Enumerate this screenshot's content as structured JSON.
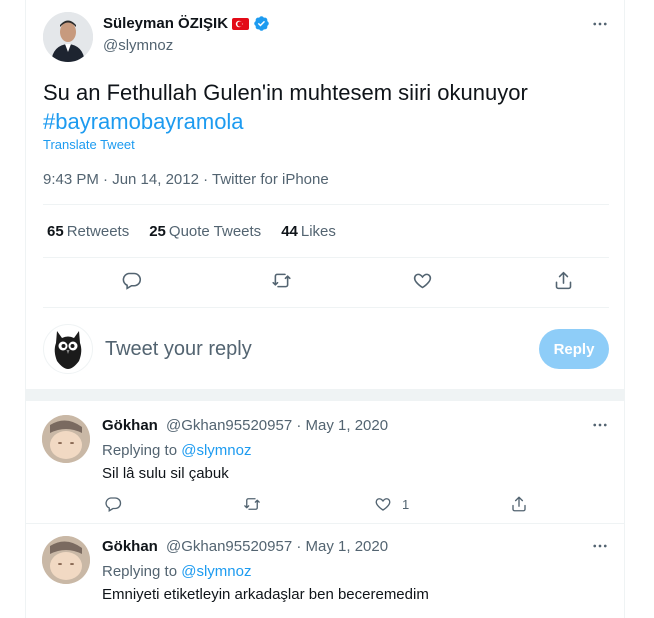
{
  "tweet": {
    "display_name": "Süleyman ÖZIŞIK",
    "handle": "@slymnoz",
    "text_main": "Su an Fethullah Gulen'in muhtesem siiri okunuyor",
    "hashtag": "#bayramobayramola",
    "translate_label": "Translate Tweet",
    "meta": "9:43 PM · Jun 14, 2012 · Twitter for iPhone",
    "stats": {
      "retweets_count": "65",
      "retweets_label": "Retweets",
      "quotes_count": "25",
      "quotes_label": "Quote Tweets",
      "likes_count": "44",
      "likes_label": "Likes"
    },
    "action_icons": [
      "reply-icon",
      "retweet-icon",
      "like-icon",
      "share-icon"
    ]
  },
  "compose": {
    "placeholder": "Tweet your reply",
    "reply_button": "Reply"
  },
  "replies": [
    {
      "name": "Gökhan",
      "handle": "@Gkhan95520957",
      "date": "· May 1, 2020",
      "replying_prefix": "Replying to",
      "replying_to": "@slymnoz",
      "text": "Sil lâ sulu sil çabuk",
      "like_count": "1"
    },
    {
      "name": "Gökhan",
      "handle": "@Gkhan95520957",
      "date": "· May 1, 2020",
      "replying_prefix": "Replying to",
      "replying_to": "@slymnoz",
      "text": "Emniyeti etiketleyin arkadaşlar ben beceremedim"
    }
  ],
  "colors": {
    "accent": "#1d9bf0",
    "reply_button_disabled": "#8ecdf8",
    "secondary_text": "#536471",
    "flag_red": "#e30a17"
  }
}
